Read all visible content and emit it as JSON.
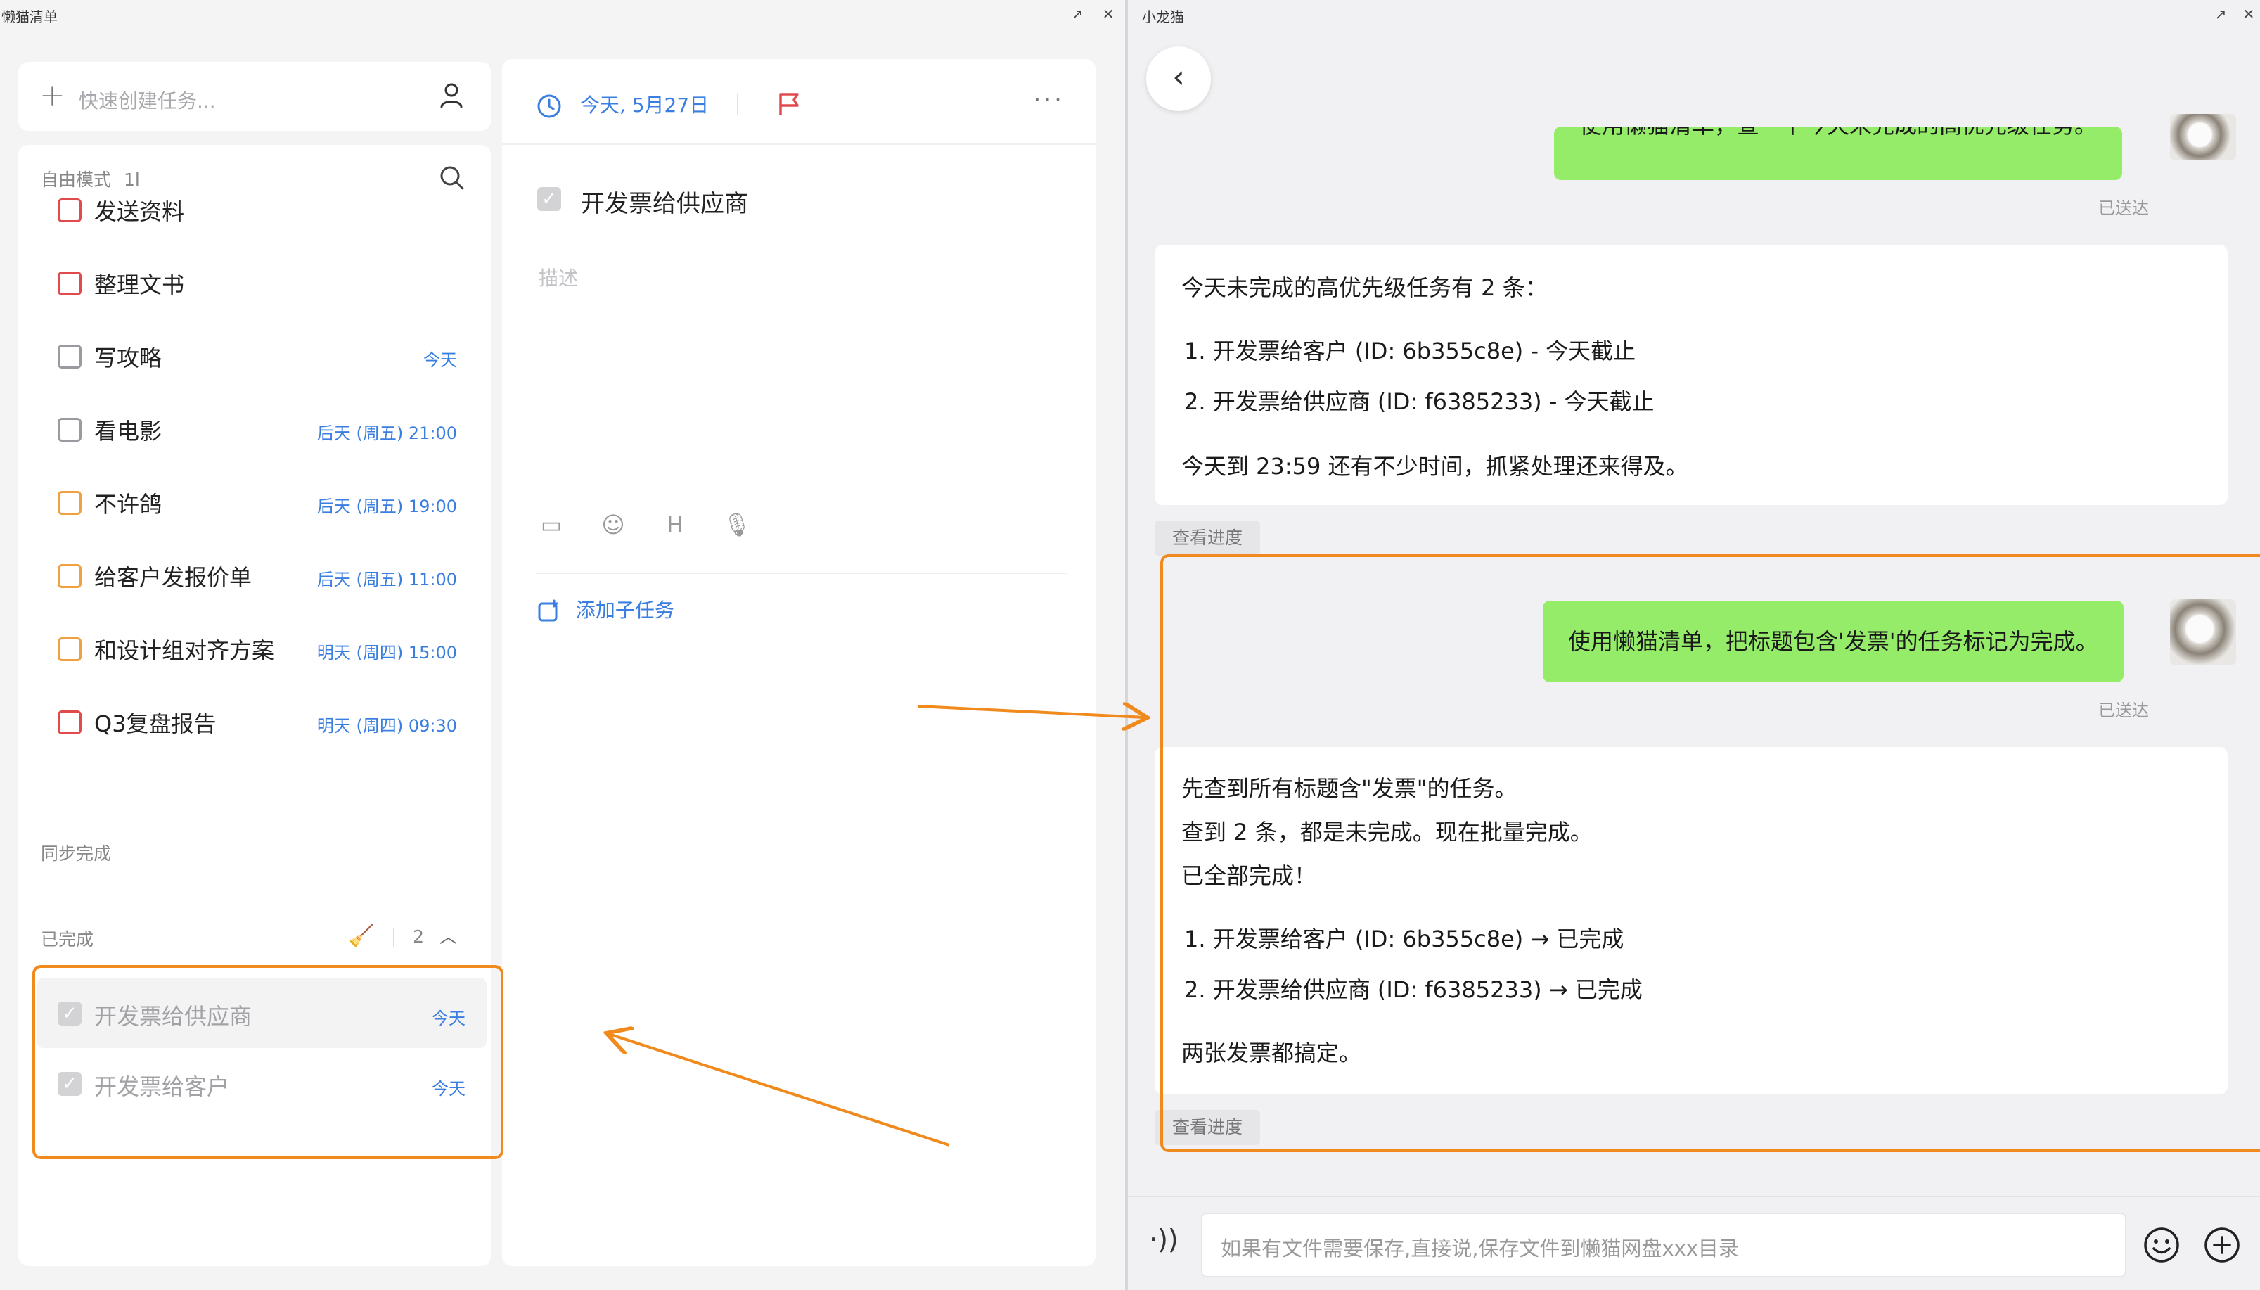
{
  "left_window": {
    "title": "懒猫清单",
    "quick_add": {
      "placeholder": "快速创建任务..."
    },
    "mode": {
      "label": "自由模式",
      "sort_icon": "1l"
    },
    "tasks": [
      {
        "label": "发送资料",
        "due": "",
        "priority": "high"
      },
      {
        "label": "整理文书",
        "due": "",
        "priority": "high"
      },
      {
        "label": "写攻略",
        "due": "今天",
        "priority": "none"
      },
      {
        "label": "看电影",
        "due": "后天 (周五) 21:00",
        "priority": "none"
      },
      {
        "label": "不许鸽",
        "due": "后天 (周五) 19:00",
        "priority": "medium"
      },
      {
        "label": "给客户发报价单",
        "due": "后天 (周五) 11:00",
        "priority": "medium"
      },
      {
        "label": "和设计组对齐方案",
        "due": "明天 (周四) 15:00",
        "priority": "medium"
      },
      {
        "label": "Q3复盘报告",
        "due": "明天 (周四) 09:30",
        "priority": "high"
      }
    ],
    "sync_section": "同步完成",
    "done_section": {
      "label": "已完成",
      "count": "2"
    },
    "done_tasks": [
      {
        "label": "开发票给供应商",
        "due": "今天"
      },
      {
        "label": "开发票给客户",
        "due": "今天"
      }
    ],
    "detail": {
      "date": "今天, 5月27日",
      "title": "开发票给供应商",
      "description_placeholder": "描述",
      "add_subtask": "添加子任务",
      "more": "···"
    }
  },
  "right_window": {
    "title": "小龙猫",
    "messages": [
      {
        "role": "user",
        "text": "使用懒猫清单，查一下今天未完成的高优先级任务。",
        "status": "已送达"
      },
      {
        "role": "bot",
        "lines": [
          "今天未完成的高优先级任务有 2 条：",
          "1. 开发票给客户 (ID: 6b355c8e) - 今天截止",
          "2. 开发票给供应商 (ID: f6385233) - 今天截止",
          "今天到 23:59 还有不少时间，抓紧处理还来得及。"
        ],
        "progress": "查看进度"
      },
      {
        "role": "user",
        "text": "使用懒猫清单，把标题包含'发票'的任务标记为完成。",
        "status": "已送达"
      },
      {
        "role": "bot",
        "lines": [
          "先查到所有标题含\"发票\"的任务。",
          "查到 2 条，都是未完成。现在批量完成。",
          "已全部完成！",
          "1. 开发票给客户 (ID: 6b355c8e) → 已完成",
          "2. 开发票给供应商 (ID: f6385233) → 已完成",
          "两张发票都搞定。"
        ],
        "progress": "查看进度"
      }
    ],
    "input": {
      "placeholder": "如果有文件需要保存,直接说,保存文件到懒猫网盘xxx目录"
    }
  },
  "colors": {
    "accent": "#3a7ee0",
    "priority_high": "#e24b4b",
    "priority_medium": "#f0a040",
    "bubble_user": "#95ec69",
    "highlight": "#f08a1c"
  }
}
